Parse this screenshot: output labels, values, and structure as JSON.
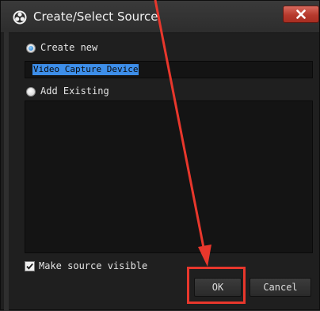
{
  "window": {
    "title": "Create/Select Source"
  },
  "form": {
    "create_new_label": "Create new",
    "create_new_checked": true,
    "source_name_value": "Video Capture Device",
    "add_existing_label": "Add Existing",
    "add_existing_checked": false,
    "make_visible_label": "Make source visible",
    "make_visible_checked": true
  },
  "buttons": {
    "ok_label": "OK",
    "cancel_label": "Cancel"
  },
  "icons": {
    "app": "obs-logo-icon",
    "close": "close-icon",
    "checkbox": "checkmark-icon",
    "annotation": "red-arrow-icon"
  },
  "colors": {
    "annotation": "#e8372c",
    "selection": "#3d8ee9",
    "close_button": "#c0463a"
  }
}
